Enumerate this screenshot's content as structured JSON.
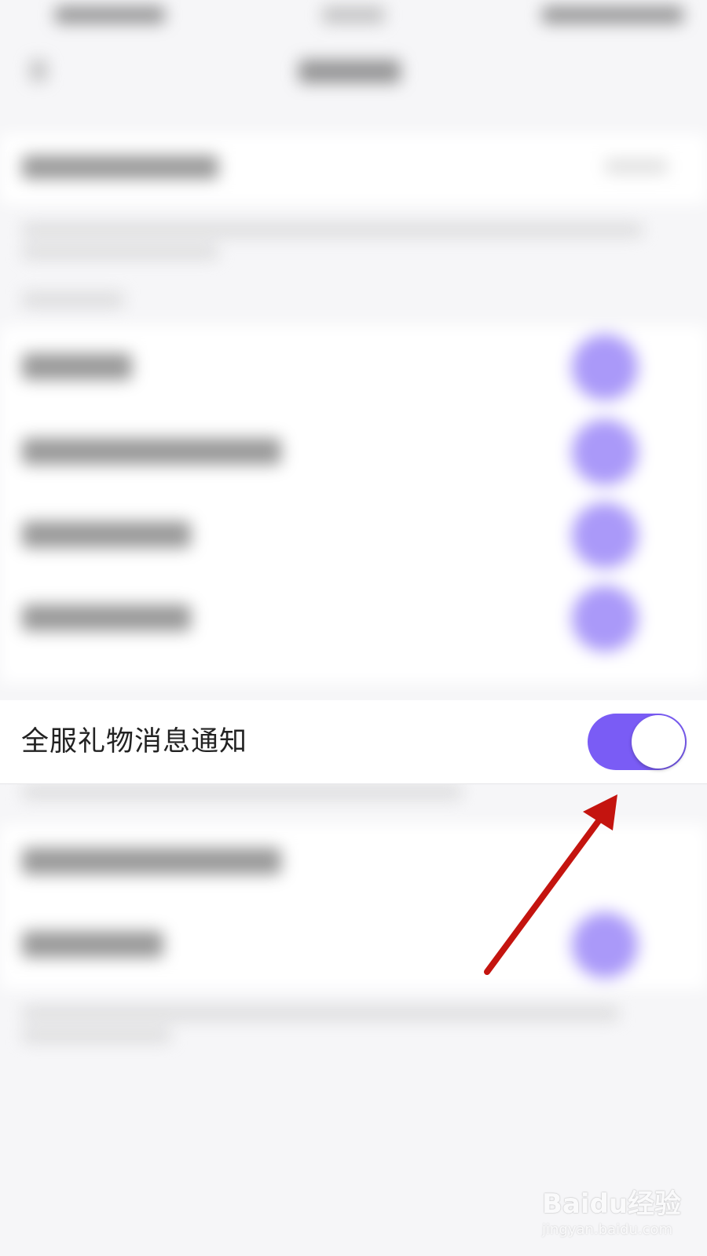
{
  "settings_row": {
    "label": "全服礼物消息通知",
    "toggle_on": true
  },
  "colors": {
    "accent": "#7a5cf5",
    "blurred_toggle": "#9b87f8",
    "arrow": "#c4140f",
    "background": "#f6f6f8"
  },
  "watermark": {
    "brand": "Baidu经验",
    "url": "jingyan.baidu.com"
  }
}
